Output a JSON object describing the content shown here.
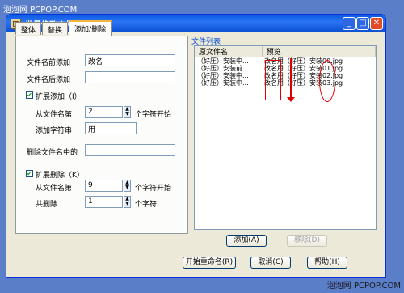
{
  "watermark": {
    "top": "泡泡网 PCPOP.COM",
    "bottom": "泡泡网 PCPOP.COM"
  },
  "window": {
    "title": "批量修改文件名 － 好压"
  },
  "tabs": [
    {
      "label": "整体"
    },
    {
      "label": "替换"
    },
    {
      "label": "添加/删除"
    }
  ],
  "panel": {
    "prefix_label": "文件名前添加",
    "prefix_value": "改名",
    "suffix_label": "文件名后添加",
    "suffix_value": "",
    "ext_add_label": "扩展添加（I）",
    "from_pos_label": "从文件名第",
    "from_pos_value": "2",
    "from_pos_unit": "个字符开始",
    "add_chars_label": "添加字符串",
    "add_chars_value": "用",
    "delete_in_label": "删除文件名中的",
    "delete_in_value": "",
    "ext_delete_label": "扩展删除（K）",
    "del_from_label": "从文件名第",
    "del_from_value": "9",
    "del_from_unit": "个字符开始",
    "del_count_label": "共删除",
    "del_count_value": "1",
    "del_count_unit": "个字符"
  },
  "file_list": {
    "title": "文件列表",
    "columns": [
      "原文件名",
      "预览"
    ],
    "rows": [
      {
        "original": "（好压）安装中...",
        "preview": "改名用（好压）安装00.jpg"
      },
      {
        "original": "（好压）安装前...",
        "preview": "改名用（好压）安装01.jpg"
      },
      {
        "original": "（好压）安装中...",
        "preview": "改名用（好压）安装02.jpg"
      },
      {
        "original": "（好压）安装中...",
        "preview": "改名用（好压）安装03.jpg"
      }
    ]
  },
  "buttons": {
    "add": "添加(A)",
    "remove": "移除(D)",
    "start": "开始重命名(R)",
    "cancel": "取消(C)",
    "help": "帮助(H)"
  }
}
